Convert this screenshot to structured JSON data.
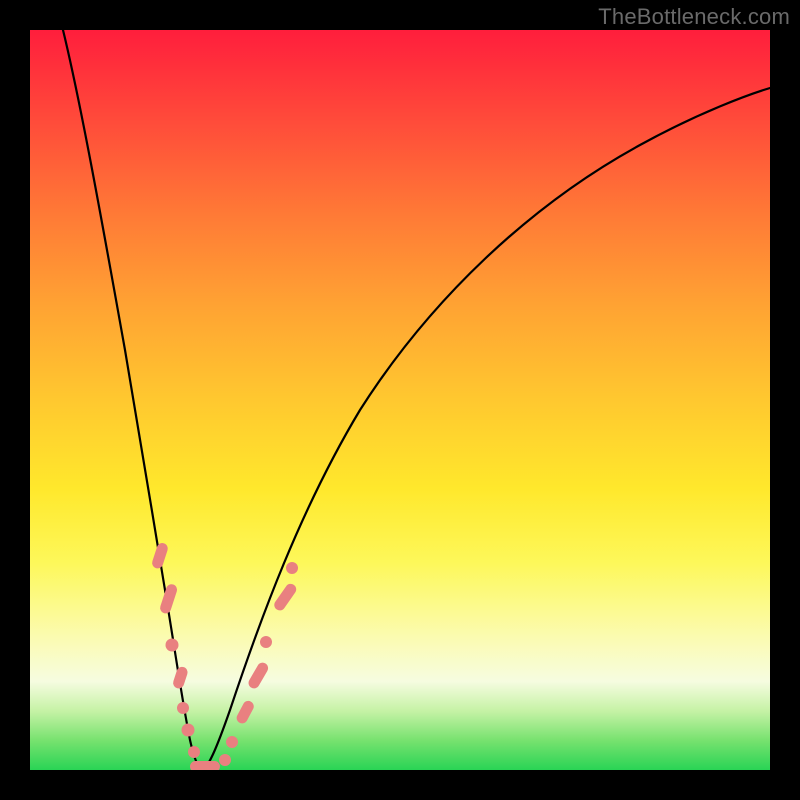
{
  "watermark": "TheBottleneck.com",
  "colors": {
    "background": "#000000",
    "gradient_top": "#ff1e3c",
    "gradient_mid": "#ffe82c",
    "gradient_bottom": "#29d455",
    "curve_stroke": "#000000",
    "marker_fill": "#e98080"
  },
  "chart_data": {
    "type": "line",
    "title": "",
    "xlabel": "",
    "ylabel": "",
    "xlim": [
      0,
      100
    ],
    "ylim": [
      0,
      100
    ],
    "grid": false,
    "legend": false,
    "notes": "Two nearly-coincident V-shaped curves with a sharp minimum near x≈22. Background vertical gradient encodes value from red (high, top) to green (low, bottom). Salmon-pink dots/pills mark sampled points near the trough on both branches.",
    "series": [
      {
        "name": "curve_left",
        "x": [
          4,
          6,
          8,
          10,
          12,
          14,
          16,
          17,
          18,
          19,
          20,
          21,
          22
        ],
        "y": [
          100,
          88,
          76,
          64,
          52,
          40,
          28,
          22,
          16,
          10,
          6,
          2,
          0
        ]
      },
      {
        "name": "curve_right",
        "x": [
          22,
          24,
          26,
          30,
          35,
          40,
          50,
          60,
          70,
          80,
          90,
          100
        ],
        "y": [
          0,
          6,
          14,
          28,
          42,
          53,
          67,
          76,
          82,
          86,
          89,
          91
        ]
      }
    ],
    "markers": [
      {
        "series": "curve_left",
        "x": 16.0,
        "y": 28,
        "shape": "pill",
        "angle": -72
      },
      {
        "series": "curve_left",
        "x": 16.8,
        "y": 23,
        "shape": "pill",
        "angle": -72
      },
      {
        "series": "curve_left",
        "x": 17.8,
        "y": 17,
        "shape": "dot"
      },
      {
        "series": "curve_left",
        "x": 18.6,
        "y": 12,
        "shape": "pill",
        "angle": -72
      },
      {
        "series": "curve_left",
        "x": 19.4,
        "y": 8,
        "shape": "dot"
      },
      {
        "series": "curve_left",
        "x": 20.2,
        "y": 4,
        "shape": "dot"
      },
      {
        "series": "trough",
        "x": 21.0,
        "y": 1,
        "shape": "dot"
      },
      {
        "series": "trough",
        "x": 22.0,
        "y": 0,
        "shape": "pill",
        "angle": 0
      },
      {
        "series": "trough",
        "x": 23.0,
        "y": 0,
        "shape": "dot"
      },
      {
        "series": "curve_right",
        "x": 24.0,
        "y": 3,
        "shape": "dot"
      },
      {
        "series": "curve_right",
        "x": 25.0,
        "y": 8,
        "shape": "pill",
        "angle": 62
      },
      {
        "series": "curve_right",
        "x": 26.0,
        "y": 14,
        "shape": "pill",
        "angle": 60
      },
      {
        "series": "curve_right",
        "x": 27.2,
        "y": 20,
        "shape": "dot"
      },
      {
        "series": "curve_right",
        "x": 28.5,
        "y": 26,
        "shape": "pill",
        "angle": 55
      },
      {
        "series": "curve_right",
        "x": 29.5,
        "y": 30,
        "shape": "dot"
      }
    ]
  }
}
